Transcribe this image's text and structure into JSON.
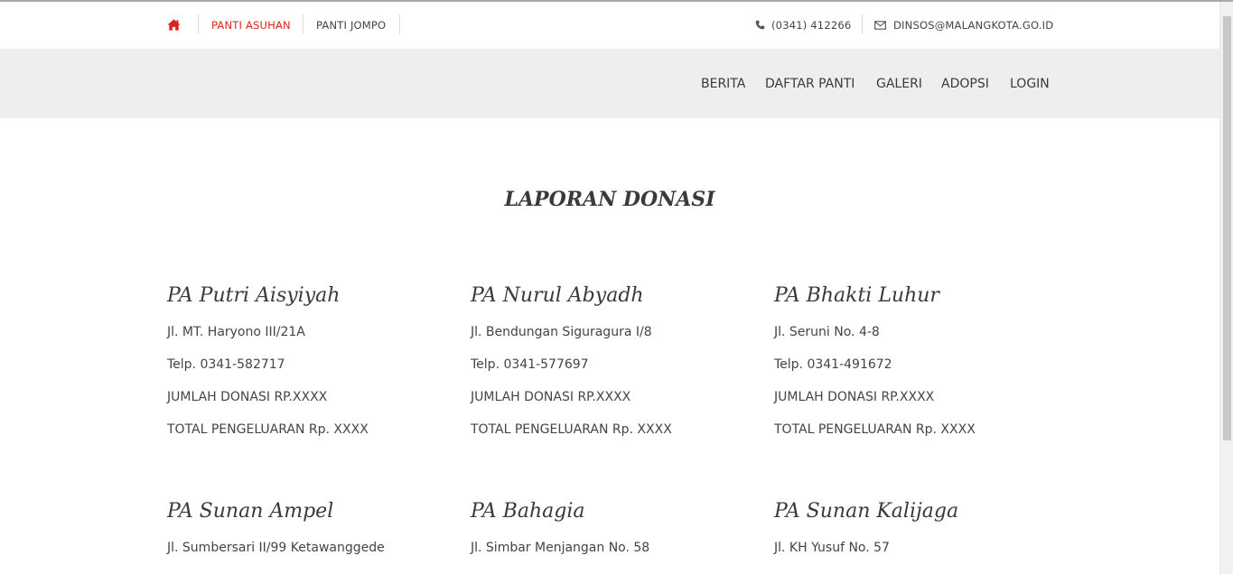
{
  "topbar": {
    "links": [
      "PANTI ASUHAN",
      "PANTI JOMPO"
    ],
    "phone": "(0341) 412266",
    "email": "DINSOS@MALANGKOTA.GO.ID"
  },
  "nav": {
    "items": [
      "BERITA",
      "DAFTAR PANTI",
      "GALERI",
      "ADOPSI",
      "LOGIN"
    ]
  },
  "page": {
    "title": "LAPORAN DONASI"
  },
  "cards": [
    {
      "name": "PA Putri Aisyiyah",
      "address": "Jl. MT. Haryono III/21A",
      "phone": "Telp. 0341-582717",
      "donation": "JUMLAH DONASI RP.XXXX",
      "expense": "TOTAL PENGELUARAN Rp. XXXX"
    },
    {
      "name": "PA Nurul Abyadh",
      "address": "Jl. Bendungan Siguragura I/8",
      "phone": "Telp. 0341-577697",
      "donation": "JUMLAH DONASI RP.XXXX",
      "expense": "TOTAL PENGELUARAN Rp. XXXX"
    },
    {
      "name": "PA Bhakti Luhur",
      "address": "Jl. Seruni No. 4-8",
      "phone": "Telp. 0341-491672",
      "donation": "JUMLAH DONASI RP.XXXX",
      "expense": "TOTAL PENGELUARAN Rp. XXXX"
    },
    {
      "name": "PA Sunan Ampel",
      "address": "Jl. Sumbersari II/99 Ketawanggede"
    },
    {
      "name": "PA Bahagia",
      "address": "Jl. Simbar Menjangan No. 58"
    },
    {
      "name": "PA Sunan Kalijaga",
      "address": "Jl. KH Yusuf No. 57"
    }
  ],
  "icons": {
    "home": "home-icon",
    "phone": "phone-icon",
    "email": "envelope-icon"
  },
  "colors": {
    "accent": "#d9231d",
    "navbar_bg": "#eeeeee",
    "text": "#444444"
  }
}
